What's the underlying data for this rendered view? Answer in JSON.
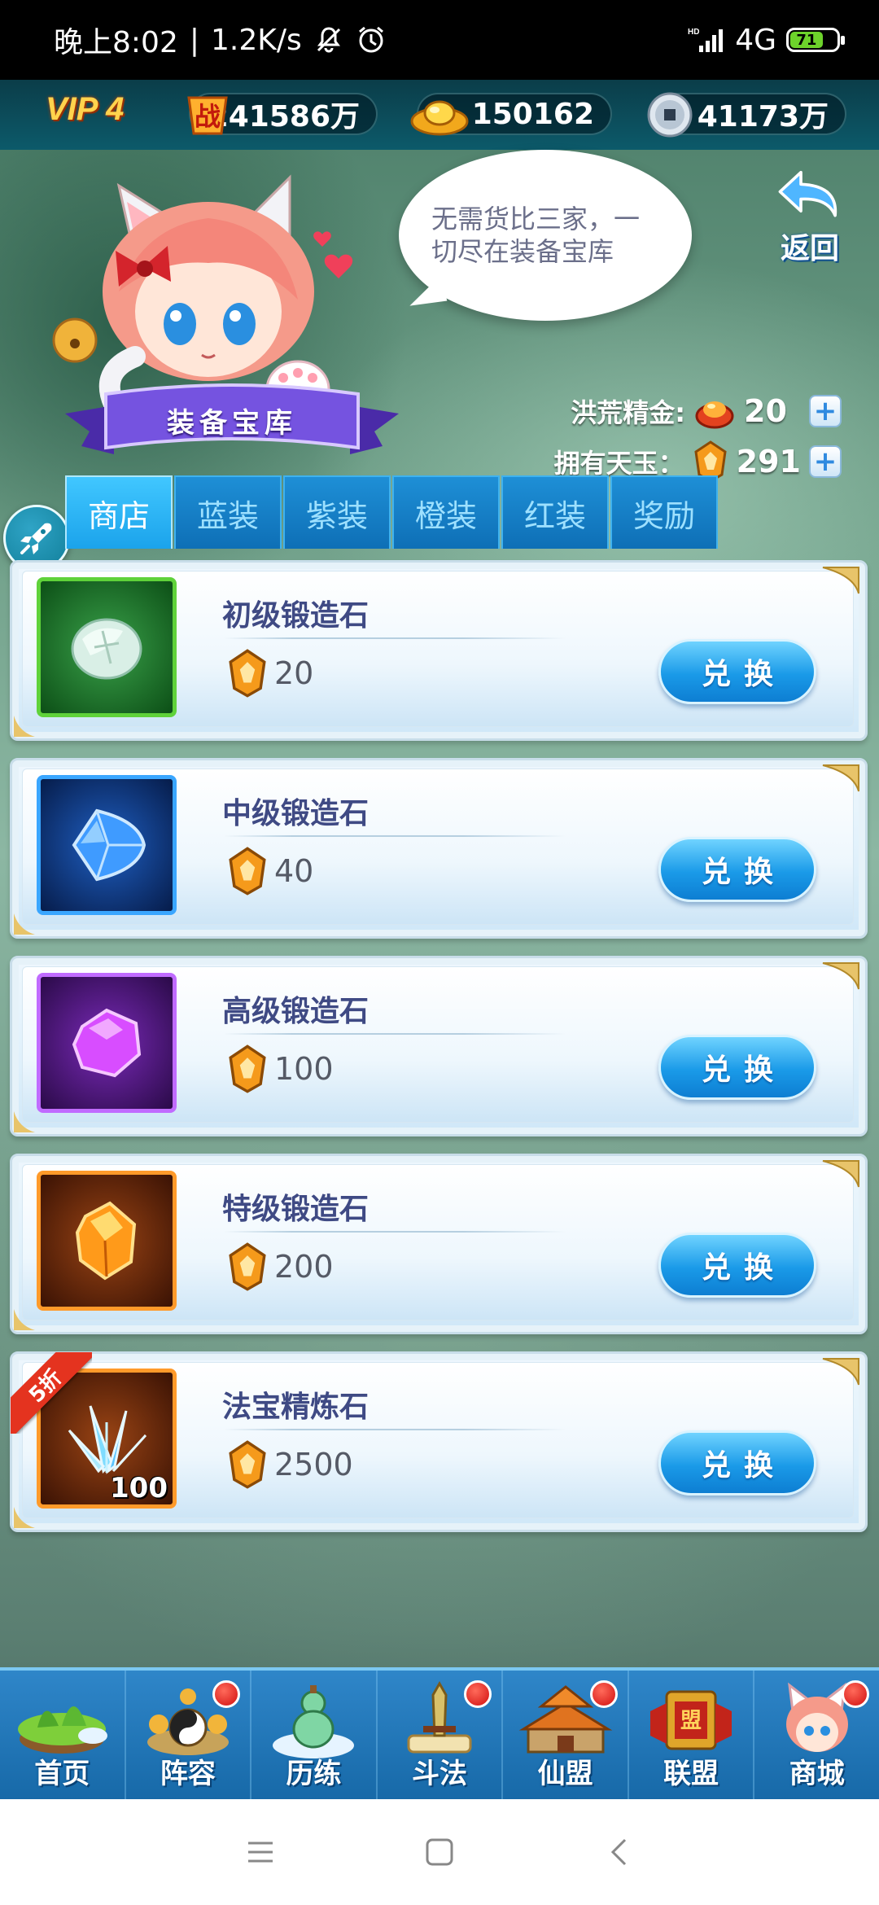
{
  "status_bar": {
    "time": "晚上8:02",
    "separator": "|",
    "net_speed": "1.2K/s",
    "network": "4G",
    "battery": "71",
    "icons": [
      "mute-icon",
      "alarm-icon",
      "signal-icon",
      "battery-icon"
    ]
  },
  "topbar": {
    "vip": "VIP 4",
    "power_icon_text": "战",
    "power": "241586万",
    "gold": "150162",
    "coin": "41173万"
  },
  "npc": {
    "speech": "无需货比三家，一切尽在装备宝库",
    "banner": "装备宝库"
  },
  "back": {
    "label": "返回"
  },
  "resources": {
    "essence_label": "洪荒精金:",
    "essence_value": "20",
    "jade_label": "拥有天玉：",
    "jade_value": "291"
  },
  "tabs": [
    {
      "label": "商店",
      "active": true
    },
    {
      "label": "蓝装",
      "active": false
    },
    {
      "label": "紫装",
      "active": false
    },
    {
      "label": "橙装",
      "active": false
    },
    {
      "label": "红装",
      "active": false
    },
    {
      "label": "奖励",
      "active": false
    }
  ],
  "items": [
    {
      "name": "初级锻造石",
      "price": "20",
      "button": "兑换",
      "rarity": "green",
      "frame": "#5fd23a",
      "bg": "#1f7a2a"
    },
    {
      "name": "中级锻造石",
      "price": "40",
      "button": "兑换",
      "rarity": "blue",
      "frame": "#3aa6ff",
      "bg": "#0f3f8e"
    },
    {
      "name": "高级锻造石",
      "price": "100",
      "button": "兑换",
      "rarity": "purple",
      "frame": "#c06bff",
      "bg": "#5a1c8e"
    },
    {
      "name": "特级锻造石",
      "price": "200",
      "button": "兑换",
      "rarity": "orange",
      "frame": "#ff9a2a",
      "bg": "#7a3512"
    },
    {
      "name": "法宝精炼石",
      "price": "2500",
      "button": "兑换",
      "rarity": "orange",
      "frame": "#ff9a2a",
      "bg": "#7a3512",
      "quantity": "100",
      "discount": "5折"
    }
  ],
  "bottom_nav": [
    {
      "label": "首页",
      "badge": false
    },
    {
      "label": "阵容",
      "badge": true
    },
    {
      "label": "历练",
      "badge": false
    },
    {
      "label": "斗法",
      "badge": true
    },
    {
      "label": "仙盟",
      "badge": true
    },
    {
      "label": "联盟",
      "badge": false,
      "art_text": "盟"
    },
    {
      "label": "商城",
      "badge": true
    }
  ],
  "colors": {
    "tab_active": "#1ba3eb",
    "tab_inactive": "#0e6fb6",
    "button": "#1a9ae8",
    "item_name": "#3f4a84",
    "badge": "#d10f0f"
  }
}
